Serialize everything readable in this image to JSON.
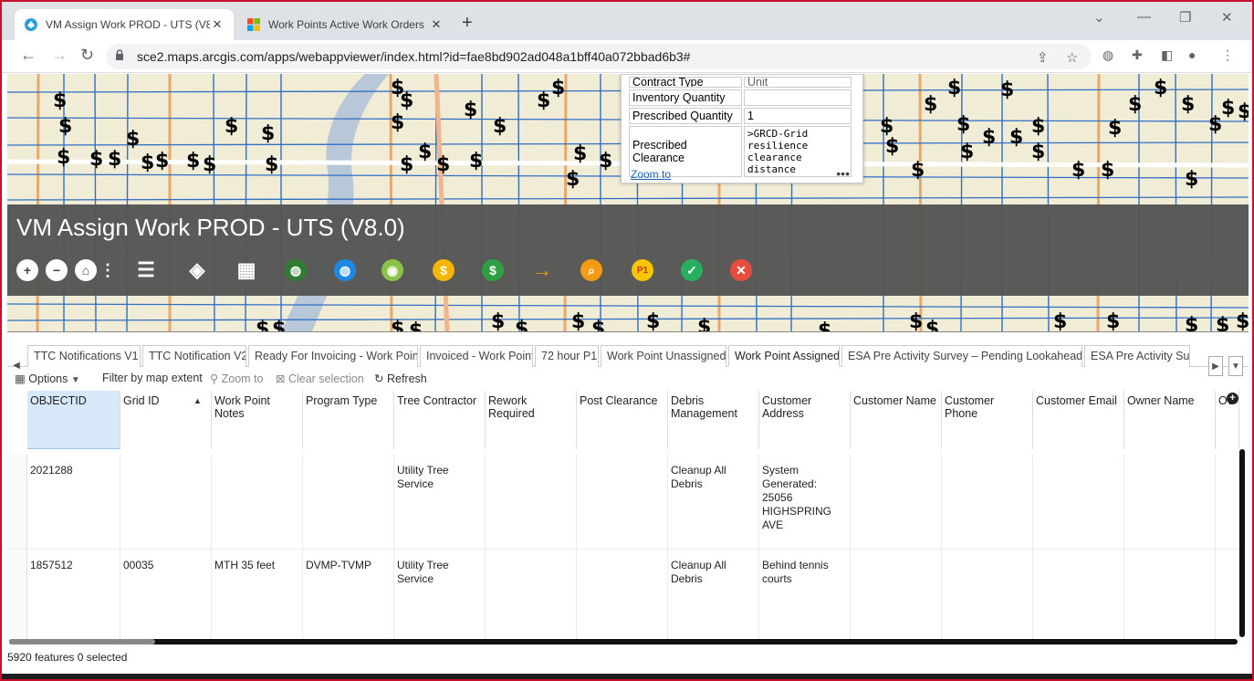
{
  "browser": {
    "tabs": [
      {
        "title": "VM Assign Work PROD - UTS (V8.0)",
        "active": true
      },
      {
        "title": "Work Points Active Work Orders",
        "active": false
      }
    ],
    "url": "sce2.maps.arcgis.com/apps/webappviewer/index.html?id=fae8bd902ad048a1bff40a072bbad6b3#"
  },
  "app": {
    "title": "VM Assign Work PROD - UTS (V8.0)",
    "widgets": [
      {
        "name": "zoom-in-icon",
        "glyph": "+",
        "bg": "#ffffff",
        "fg": "#444444"
      },
      {
        "name": "zoom-out-icon",
        "glyph": "−",
        "bg": "#ffffff",
        "fg": "#444444"
      },
      {
        "name": "home-icon",
        "glyph": "⌂",
        "bg": "#ffffff",
        "fg": "#444444"
      },
      {
        "name": "layer-list-icon",
        "glyph": "☰",
        "bg": "transparent",
        "fg": "#ffffff"
      },
      {
        "name": "layers-icon",
        "glyph": "◈",
        "bg": "transparent",
        "fg": "#ffffff"
      },
      {
        "name": "grid-icon",
        "glyph": "▦",
        "bg": "transparent",
        "fg": "#ffffff"
      },
      {
        "name": "basemap-icon",
        "glyph": "◍",
        "bg": "#2e7d32",
        "fg": "#ffffff"
      },
      {
        "name": "globe-icon",
        "glyph": "◍",
        "bg": "#1e88e5",
        "fg": "#ffffff"
      },
      {
        "name": "map-pin-icon",
        "glyph": "◉",
        "bg": "#8bc34a",
        "fg": "#ffffff"
      },
      {
        "name": "coin-icon",
        "glyph": "$",
        "bg": "#f7b500",
        "fg": "#ffffff"
      },
      {
        "name": "dollar-icon",
        "glyph": "$",
        "bg": "#2ea043",
        "fg": "#ffffff"
      },
      {
        "name": "arrow-circle-icon",
        "glyph": "→",
        "bg": "transparent",
        "fg": "#f39c12"
      },
      {
        "name": "search-icon",
        "glyph": "⌕",
        "bg": "#f39c12",
        "fg": "#ffffff"
      },
      {
        "name": "p1-icon",
        "glyph": "P1",
        "bg": "#f7c600",
        "fg": "#c0392b"
      },
      {
        "name": "check-icon",
        "glyph": "✓",
        "bg": "#27ae60",
        "fg": "#ffffff"
      },
      {
        "name": "close-icon",
        "glyph": "✕",
        "bg": "#e74c3c",
        "fg": "#ffffff"
      }
    ]
  },
  "popup": {
    "partial_label": "Contract Type",
    "partial_value": "Unit",
    "rows": [
      {
        "label": "Inventory Quantity",
        "value": ""
      },
      {
        "label": "Prescribed Quantity",
        "value": "1"
      },
      {
        "label": "Prescribed Clearance",
        "value": ">GRCD-Grid resilience clearance distance"
      }
    ],
    "zoom_label": "Zoom to",
    "more_label": "•••"
  },
  "table": {
    "tabs": [
      "TTC Notifications V1",
      "TTC Notification V2",
      "Ready For Invoicing - Work Point",
      "Invoiced - Work Point",
      "72 hour P1",
      "Work Point Unassigned",
      "Work Point Assigned",
      "ESA Pre Activity Survey – Pending Lookahead",
      "ESA Pre Activity Surv"
    ],
    "active_tab": "Work Point Assigned",
    "toolbar": {
      "options": "Options",
      "filter": "Filter by map extent",
      "zoom": "Zoom to",
      "clear": "Clear selection",
      "refresh": "Refresh"
    },
    "columns": [
      "OBJECTID",
      "Grid ID",
      "Work Point Notes",
      "Program Type",
      "Tree Contractor",
      "Rework Required",
      "Post Clearance",
      "Debris Management",
      "Customer Address",
      "Customer Name",
      "Customer Phone",
      "Customer Email",
      "Owner Name",
      "Ov"
    ],
    "rows": [
      [
        "2021288",
        "",
        "",
        "",
        "Utility Tree Service",
        "",
        "",
        "Cleanup All Debris",
        "System Generated: 25056 HIGHSPRING AVE",
        "",
        "",
        "",
        "",
        ""
      ],
      [
        "1857512",
        "00035",
        "MTH 35 feet",
        "DVMP-TVMP",
        "Utility Tree Service",
        "",
        "",
        "Cleanup All Debris",
        "Behind tennis courts",
        "",
        "",
        "",
        "",
        ""
      ]
    ],
    "status": "5920 features  0 selected"
  }
}
